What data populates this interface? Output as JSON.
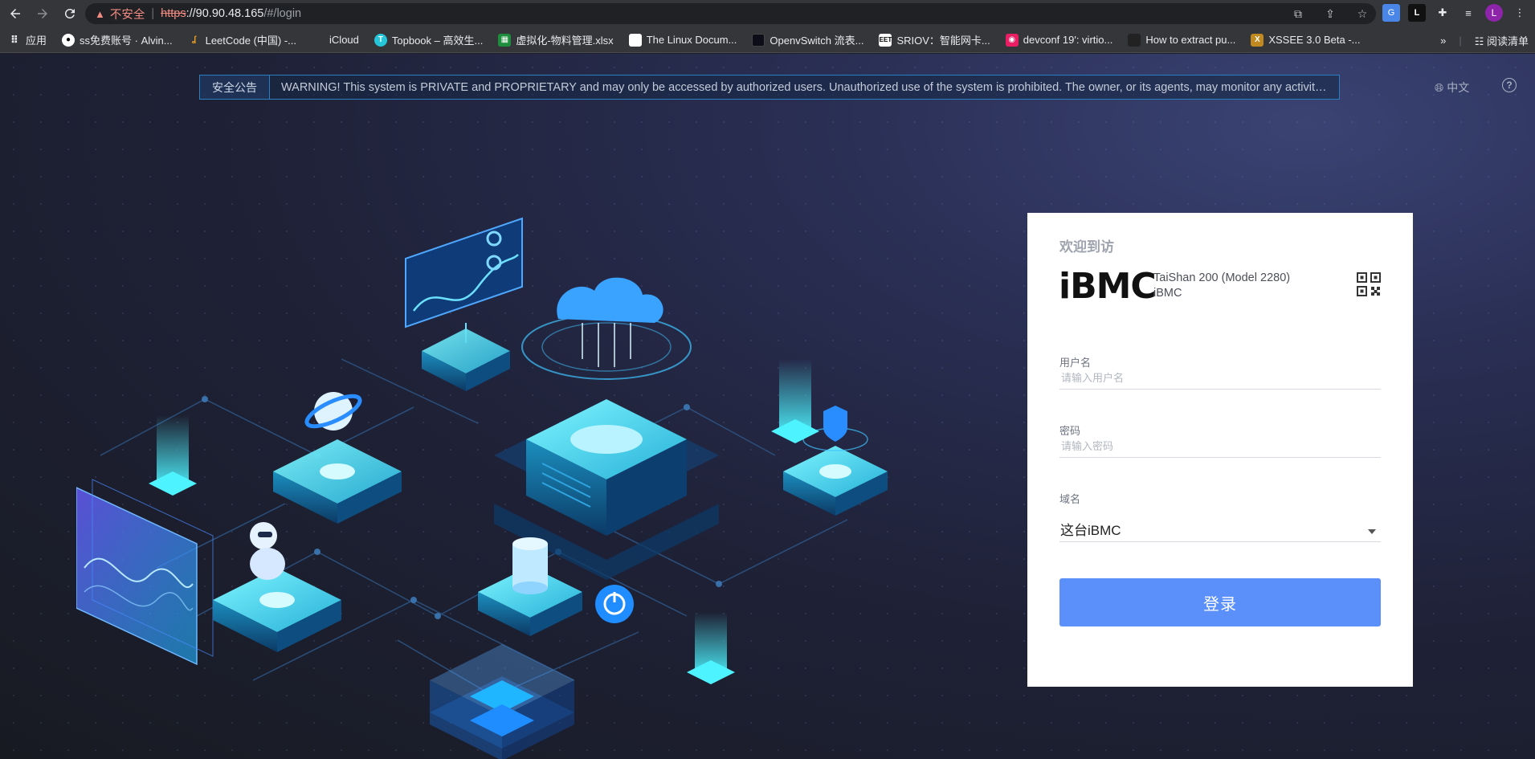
{
  "browser": {
    "insecure_label": "不安全",
    "url_scheme": "https",
    "url_host": "://90.90.48.165",
    "url_path": "/#/login",
    "avatar_letter": "L",
    "reading_list": "阅读清单",
    "bookmarks": [
      {
        "label": "应用",
        "color": "#e8eaed"
      },
      {
        "label": "ss免费账号 · Alvin...",
        "color": "#ffffff"
      },
      {
        "label": "LeetCode (中国) -...",
        "color": "#f0a020"
      },
      {
        "label": "iCloud",
        "color": "#cfcfcf"
      },
      {
        "label": "Topbook – 高效生...",
        "color": "#26c6da"
      },
      {
        "label": "虚拟化-物料管理.xlsx",
        "color": "#1e8e3e"
      },
      {
        "label": "The Linux Docum...",
        "color": "#ffffff"
      },
      {
        "label": "OpenvSwitch 流表...",
        "color": "#1a1a2e"
      },
      {
        "label": "SRIOV：智能网卡...",
        "color": "#ffffff"
      },
      {
        "label": "devconf 19': virtio...",
        "color": "#e91e63"
      },
      {
        "label": "How to extract pu...",
        "color": "#222222"
      },
      {
        "label": "XSSEE 3.0 Beta -...",
        "color": "#c08a20"
      }
    ]
  },
  "notice": {
    "tag": "安全公告",
    "text": "WARNING! This system is PRIVATE and PROPRIETARY and may only be accessed by authorized users. Unauthorized use of the system is prohibited. The owner, or its agents, may monitor any activity or communication on the system."
  },
  "header": {
    "language": "中文",
    "help": "?"
  },
  "login": {
    "welcome": "欢迎到访",
    "brand": "iBMC",
    "model_line1": "TaiShan 200 (Model 2280)",
    "model_line2": "iBMC",
    "username_label": "用户名",
    "username_placeholder": "请输入用户名",
    "password_label": "密码",
    "password_placeholder": "请输入密码",
    "domain_label": "域名",
    "domain_value": "这台iBMC",
    "submit": "登录"
  },
  "colors": {
    "accent": "#5b8ff9",
    "insecure": "#f28b82",
    "notice_border": "#2b7fc0"
  }
}
